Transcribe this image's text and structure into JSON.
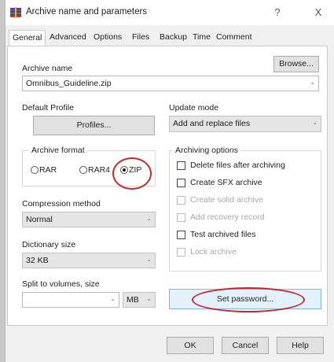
{
  "window": {
    "title": "Archive name and parameters",
    "help": "?",
    "close": "X"
  },
  "tabs": [
    "General",
    "Advanced",
    "Options",
    "Files",
    "Backup",
    "Time",
    "Comment"
  ],
  "archive_name": {
    "label": "Archive name",
    "browse": "Browse...",
    "value": "Omnibus_Guideline.zip"
  },
  "default_profile": {
    "label": "Default Profile",
    "profiles": "Profiles..."
  },
  "update_mode": {
    "label": "Update mode",
    "value": "Add and replace files"
  },
  "archive_format": {
    "label": "Archive format",
    "options": [
      "RAR",
      "RAR4",
      "ZIP"
    ],
    "selected": "ZIP"
  },
  "archiving_options": {
    "label": "Archiving options",
    "items": [
      {
        "label": "Delete files after archiving",
        "enabled": true,
        "checked": false
      },
      {
        "label": "Create SFX archive",
        "enabled": true,
        "checked": false
      },
      {
        "label": "Create solid archive",
        "enabled": false,
        "checked": false
      },
      {
        "label": "Add recovery record",
        "enabled": false,
        "checked": false
      },
      {
        "label": "Test archived files",
        "enabled": true,
        "checked": false
      },
      {
        "label": "Lock archive",
        "enabled": false,
        "checked": false
      }
    ]
  },
  "compression": {
    "label": "Compression method",
    "value": "Normal"
  },
  "dictionary": {
    "label": "Dictionary size",
    "value": "32 KB"
  },
  "split": {
    "label": "Split to volumes, size",
    "value": "",
    "unit": "MB"
  },
  "set_password": "Set password...",
  "buttons": {
    "ok": "OK",
    "cancel": "Cancel",
    "help": "Help"
  },
  "colors": {
    "highlight_ring": "#c8282a",
    "panel": "#ffffff",
    "dialog": "#f0f0f0"
  }
}
